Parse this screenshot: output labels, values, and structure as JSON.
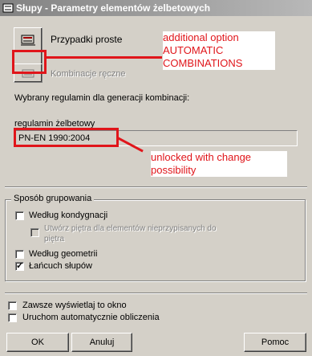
{
  "window": {
    "title": "Słupy - Parametry elementów żelbetowych"
  },
  "options": {
    "simple_cases": "Przypadki proste",
    "manual_combinations": "Kombinacje ręczne",
    "code_heading": "Wybrany regulamin dla generacji kombinacji:",
    "code_label": "regulamin żelbetowy",
    "code_value": "PN-EN 1990:2004"
  },
  "grouping": {
    "title": "Sposób grupowania",
    "by_storey": "Według kondygnacji",
    "create_floors": "Utwórz piętra dla elementów nieprzypisanych do piętra",
    "by_geometry": "Według geometrii",
    "column_chain": "Łańcuch słupów"
  },
  "footer": {
    "always_show": "Zawsze wyświetlaj to okno",
    "auto_calc": "Uruchom automatycznie obliczenia"
  },
  "buttons": {
    "ok": "OK",
    "cancel": "Anuluj",
    "help": "Pomoc"
  },
  "annotations": {
    "additional": "additional option AUTOMATIC COMBINATIONS",
    "unlocked": "unlocked with change possibility"
  },
  "checked": {
    "by_storey": false,
    "create_floors": false,
    "by_geometry": false,
    "column_chain": true,
    "always_show": false,
    "auto_calc": false
  },
  "colors": {
    "dialog": "#d4d0c8",
    "annotation_red": "#e0151a",
    "title_bar": "#a0a0a0"
  }
}
